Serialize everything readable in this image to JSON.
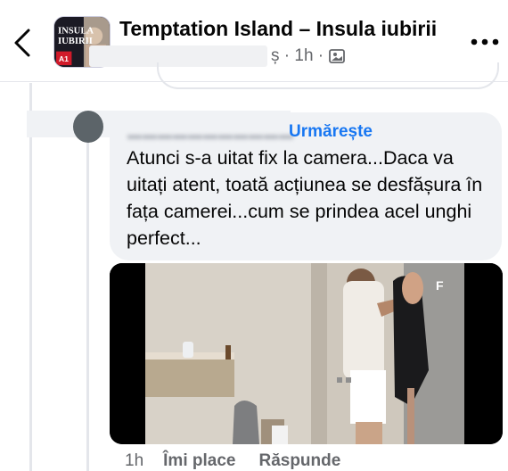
{
  "header": {
    "title": "Temptation Island – Insula iubirii",
    "subline_text": "ș · 1h ·",
    "back_icon": "chevron-left-icon",
    "more_icon": "more-horizontal-icon",
    "photo_icon": "photo-icon"
  },
  "group_avatar": {
    "text_line1": "INSULA",
    "text_line2": "IUBIRII"
  },
  "comment": {
    "follow_label": "Urmărește",
    "text": "Atunci s-a uitat fix la camera...Daca va uitați atent, toată acțiunea se desfășura în fața camerei...cum se prindea acel unghi perfect..."
  },
  "video": {
    "watermark": "F"
  },
  "actions": {
    "time": "1h",
    "like_label": "Îmi place",
    "reply_label": "Răspunde"
  },
  "colors": {
    "link": "#1877f2",
    "secondary_text": "#65676b",
    "bubble": "#f0f2f5"
  }
}
